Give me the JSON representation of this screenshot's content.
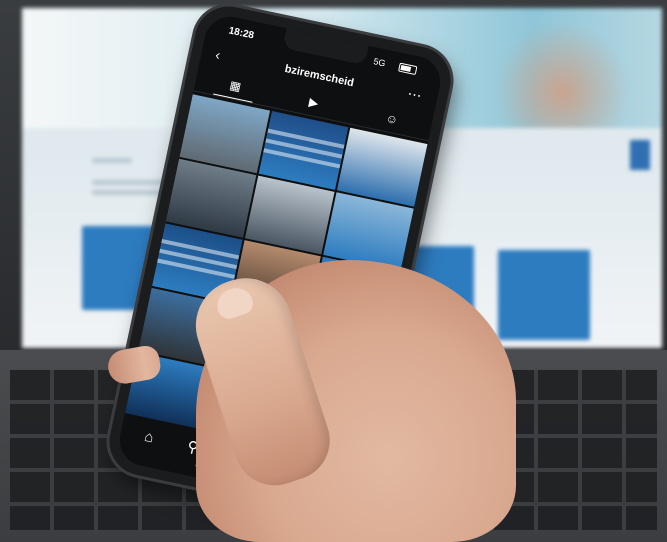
{
  "scene": {
    "description_icons": [
      "laptop",
      "smartphone",
      "hand"
    ]
  },
  "phone": {
    "status": {
      "time": "18:28",
      "network": "5G"
    },
    "header": {
      "username": "bziremscheid"
    },
    "colors": {
      "accent_blue": "#2d7cc0",
      "background": "#0e0f10"
    }
  }
}
